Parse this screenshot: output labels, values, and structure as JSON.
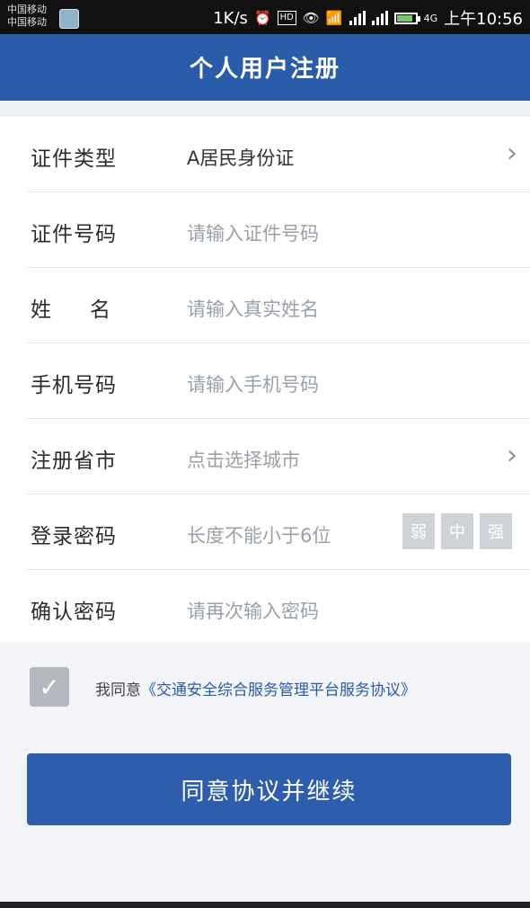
{
  "status": {
    "carrier1": "中国移动",
    "carrier2": "中国移动",
    "speed": "1K/s",
    "hd": "HD",
    "network": "4G",
    "time": "上午10:56"
  },
  "header": {
    "title": "个人用户注册"
  },
  "form": {
    "id_type": {
      "label": "证件类型",
      "value": "A居民身份证"
    },
    "id_number": {
      "label": "证件号码",
      "placeholder": "请输入证件号码"
    },
    "name": {
      "label": "姓名",
      "placeholder": "请输入真实姓名"
    },
    "phone": {
      "label": "手机号码",
      "placeholder": "请输入手机号码"
    },
    "region": {
      "label": "注册省市",
      "placeholder": "点击选择城市"
    },
    "password": {
      "label": "登录密码",
      "placeholder": "长度不能小于6位",
      "strength": [
        "弱",
        "中",
        "强"
      ]
    },
    "confirm": {
      "label": "确认密码",
      "placeholder": "请再次输入密码"
    }
  },
  "agreement": {
    "checked": true,
    "prefix": "我同意",
    "link": "《交通安全综合服务管理平台服务协议》"
  },
  "submit": {
    "label": "同意协议并继续"
  },
  "colors": {
    "primary": "#2a5caa",
    "background": "#f2f4f7",
    "placeholder": "#9aa0a8"
  }
}
